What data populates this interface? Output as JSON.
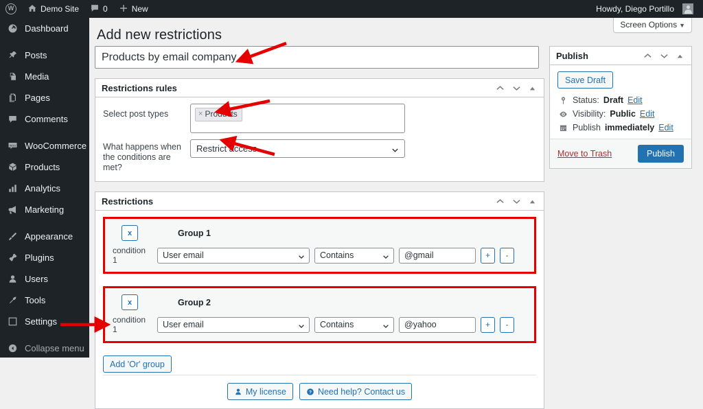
{
  "adminbar": {
    "logo_icon": "wordpress-logo-icon",
    "site_icon": "home-icon",
    "site_name": "Demo Site",
    "comments_icon": "comment-bubble-icon",
    "comments_count": "0",
    "new_icon": "plus-icon",
    "new_label": "New",
    "howdy": "Howdy, Diego Portillo",
    "avatar_name": "avatar"
  },
  "sidebar": {
    "items": [
      {
        "label": "Dashboard",
        "icon": "dashboard-icon"
      },
      {
        "label": "Posts",
        "icon": "pin-icon"
      },
      {
        "label": "Media",
        "icon": "media-icon"
      },
      {
        "label": "Pages",
        "icon": "pages-icon"
      },
      {
        "label": "Comments",
        "icon": "comment-bubble-icon"
      },
      {
        "label": "WooCommerce",
        "icon": "woocommerce-icon"
      },
      {
        "label": "Products",
        "icon": "box-icon"
      },
      {
        "label": "Analytics",
        "icon": "bar-chart-icon"
      },
      {
        "label": "Marketing",
        "icon": "megaphone-icon"
      },
      {
        "label": "Appearance",
        "icon": "paintbrush-icon"
      },
      {
        "label": "Plugins",
        "icon": "plug-icon"
      },
      {
        "label": "Users",
        "icon": "user-icon"
      },
      {
        "label": "Tools",
        "icon": "wrench-icon"
      },
      {
        "label": "Settings",
        "icon": "settings-sliders-icon"
      }
    ],
    "collapse": {
      "label": "Collapse menu",
      "icon": "collapse-arrow-icon"
    }
  },
  "screen_options": {
    "label": "Screen Options",
    "caret": "▼"
  },
  "page": {
    "title": "Add new restrictions",
    "title_input_value": "Products by email company"
  },
  "rules_panel": {
    "heading": "Restrictions rules",
    "post_types_label": "Select post types",
    "post_types_tokens": [
      {
        "remove": "×",
        "label": "Products"
      }
    ],
    "conditions_label": "What happens when the conditions are met?",
    "action_value": "Restrict access"
  },
  "restrictions_panel": {
    "heading": "Restrictions",
    "groups": [
      {
        "remove_label": "x",
        "name": "Group 1",
        "condition_label": "condition 1",
        "field": "User email",
        "operator": "Contains",
        "value": "@gmail",
        "add_label": "+",
        "remove_cond_label": "-"
      },
      {
        "remove_label": "x",
        "name": "Group 2",
        "condition_label": "condition 1",
        "field": "User email",
        "operator": "Contains",
        "value": "@yahoo",
        "add_label": "+",
        "remove_cond_label": "-"
      }
    ],
    "add_or_group": "Add 'Or' group",
    "license_button": {
      "label": "My license",
      "icon": "user-icon"
    },
    "help_button": {
      "label": "Need help? Contact us",
      "icon": "question-circle-icon"
    }
  },
  "publish": {
    "heading": "Publish",
    "save_draft": "Save Draft",
    "status_icon": "pin-marker-icon",
    "status_label": "Status:",
    "status_value": "Draft",
    "status_edit": "Edit",
    "visibility_icon": "eye-icon",
    "visibility_label": "Visibility:",
    "visibility_value": "Public",
    "visibility_edit": "Edit",
    "schedule_icon": "calendar-icon",
    "schedule_label": "Publish",
    "schedule_value": "immediately",
    "schedule_edit": "Edit",
    "trash": "Move to Trash",
    "publish_button": "Publish"
  },
  "colors": {
    "admin_dark": "#1d2327",
    "wp_blue": "#2271b1",
    "annotation_red": "#e50000",
    "canvas": "#f0f0f1",
    "trash_red": "#b32d2e"
  }
}
